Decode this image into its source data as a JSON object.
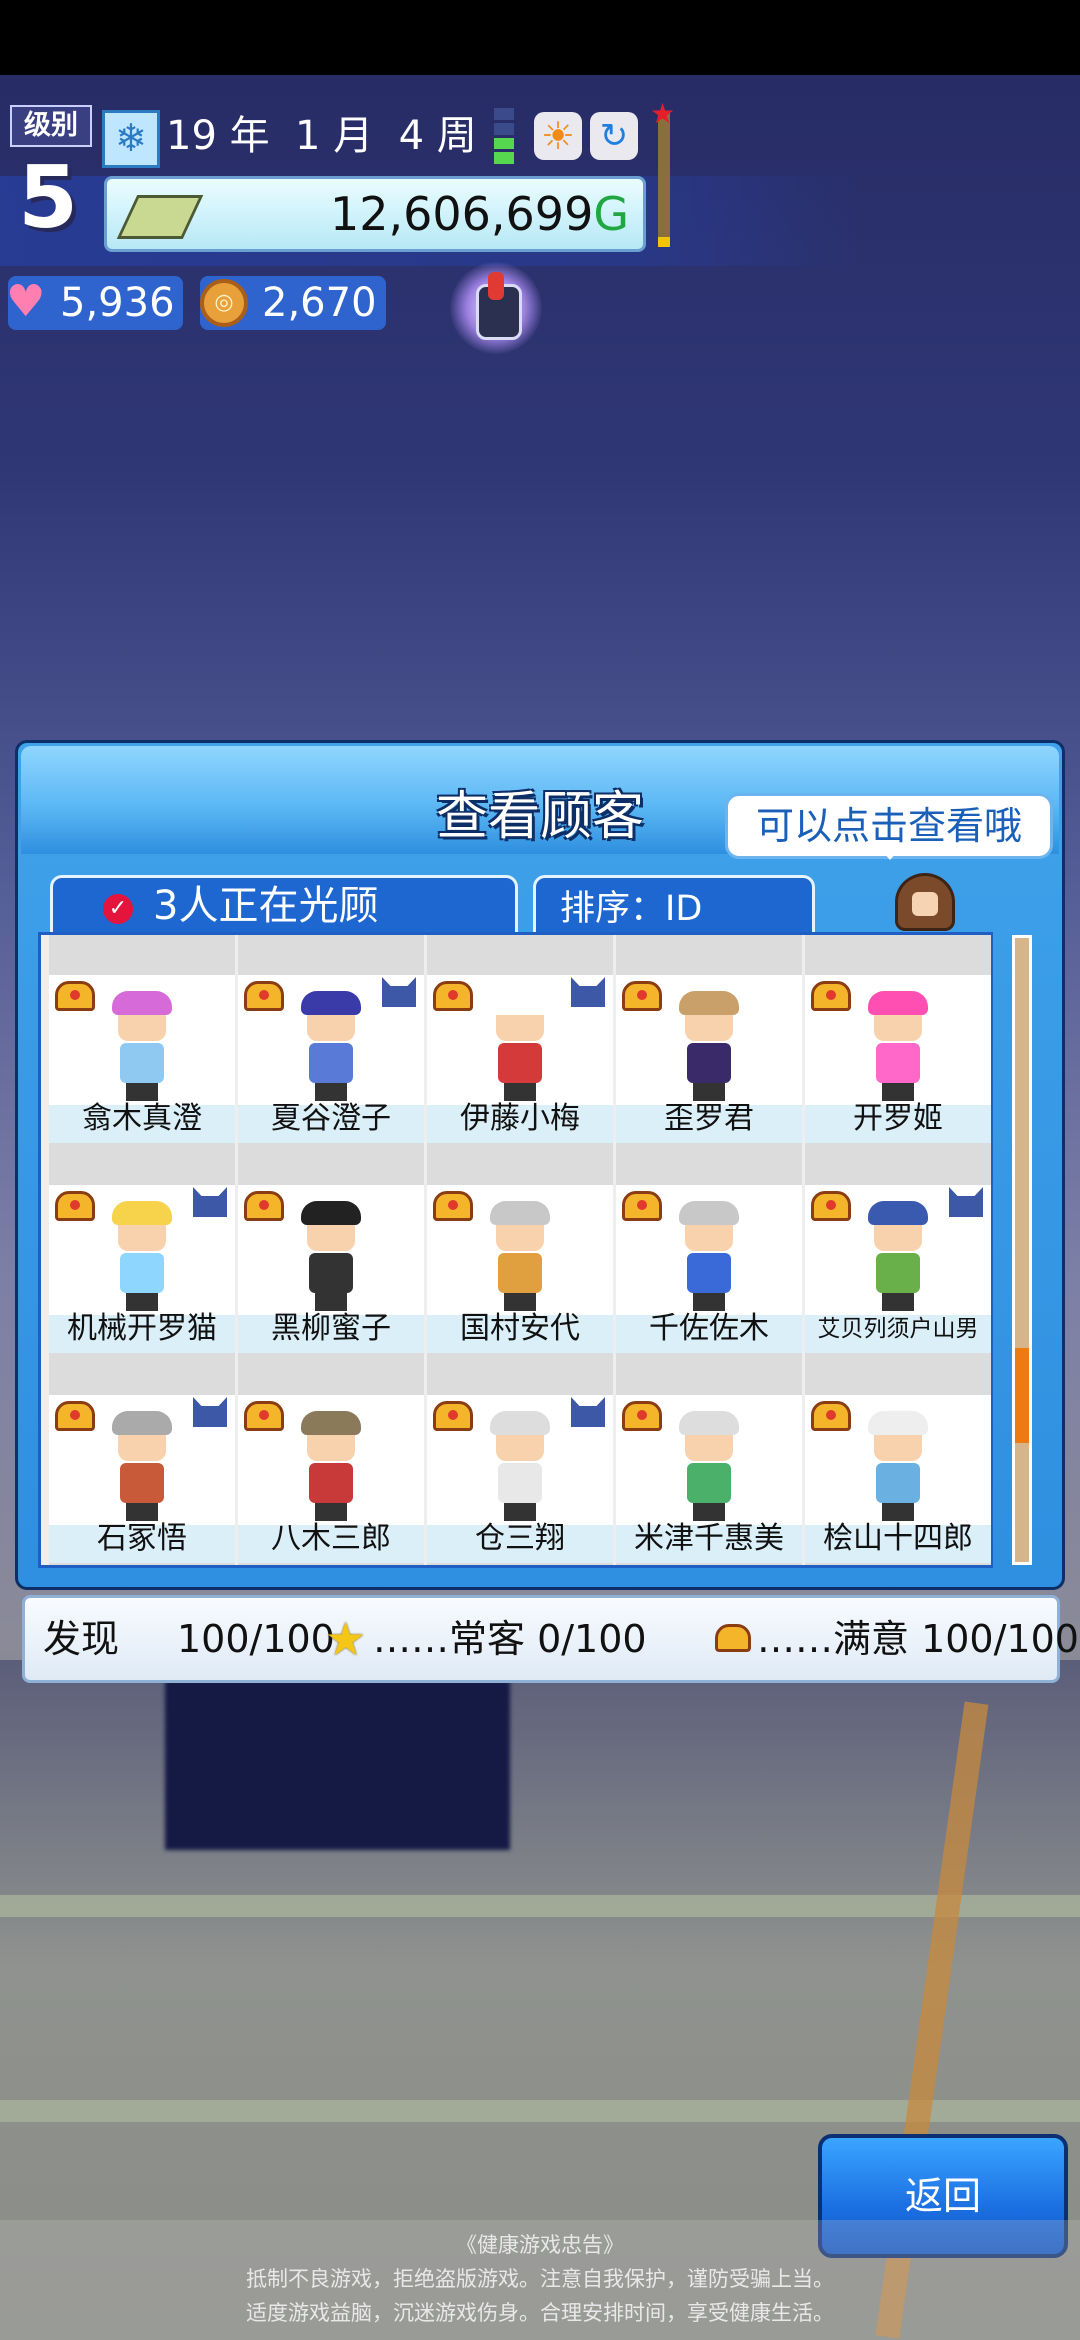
{
  "hud": {
    "level_label": "级别",
    "level": "5",
    "date": "19 年  1 月  4 周",
    "money": "12,606,699",
    "money_unit": "G",
    "hearts": "5,936",
    "coins": "2,670",
    "icons": [
      "snowflake-icon",
      "weather-sun-icon",
      "speed-icon",
      "alarm-icon",
      "heart-icon",
      "coin-icon",
      "money-icon"
    ]
  },
  "dialog": {
    "title": "查看顾客",
    "tip": "可以点击查看哦",
    "tab_visiting": "3人正在光顾",
    "tab_sort": "排序：ID"
  },
  "customers": [
    {
      "name": "翕木真澄",
      "crown": true,
      "cat": false,
      "hair": "#d56ad8",
      "shirt": "#8fc8f0"
    },
    {
      "name": "夏谷澄子",
      "crown": true,
      "cat": true,
      "hair": "#3a3aa8",
      "shirt": "#5a7ad8"
    },
    {
      "name": "伊藤小梅",
      "crown": true,
      "cat": true,
      "hair": "#ffffff",
      "shirt": "#d43a3a"
    },
    {
      "name": "歪罗君",
      "crown": true,
      "cat": false,
      "hair": "#c9a06a",
      "shirt": "#3b2a6a"
    },
    {
      "name": "开罗姬",
      "crown": true,
      "cat": false,
      "hair": "#ff4fb3",
      "shirt": "#ff68c8"
    },
    {
      "name": "机械开罗猫",
      "crown": true,
      "cat": true,
      "hair": "#f6d34a",
      "shirt": "#8fd6ff"
    },
    {
      "name": "黑柳蜜子",
      "crown": true,
      "cat": false,
      "hair": "#222222",
      "shirt": "#333333"
    },
    {
      "name": "国村安代",
      "crown": true,
      "cat": false,
      "hair": "#c8c8c8",
      "shirt": "#e0a040"
    },
    {
      "name": "千佐佐木",
      "crown": true,
      "cat": false,
      "hair": "#c8c8c8",
      "shirt": "#3a6ad8"
    },
    {
      "name": "艾贝列须户山男",
      "crown": true,
      "cat": true,
      "hair": "#3a5ab0",
      "shirt": "#6ab04a",
      "small": true
    },
    {
      "name": "石冢悟",
      "crown": true,
      "cat": true,
      "hair": "#aaaaaa",
      "shirt": "#c85a3a"
    },
    {
      "name": "八木三郎",
      "crown": true,
      "cat": false,
      "hair": "#8a7a5a",
      "shirt": "#c83a3a"
    },
    {
      "name": "仓三翔",
      "crown": true,
      "cat": true,
      "hair": "#dddddd",
      "shirt": "#e8e8e8"
    },
    {
      "name": "米津千惠美",
      "crown": true,
      "cat": false,
      "hair": "#dddddd",
      "shirt": "#4ab06a"
    },
    {
      "name": "桧山十四郎",
      "crown": true,
      "cat": false,
      "hair": "#eeeeee",
      "shirt": "#6ab0e0"
    }
  ],
  "summary": {
    "discovered_label": "发现",
    "discovered": "100/100",
    "regular": "……常客  0/100",
    "satisfied": "……满意 100/100"
  },
  "back_button": "返回",
  "notice": {
    "line1": "《健康游戏忠告》",
    "line2": "抵制不良游戏，拒绝盗版游戏。注意自我保护，谨防受骗上当。",
    "line3": "适度游戏益脑，沉迷游戏伤身。合理安排时间，享受健康生活。"
  }
}
